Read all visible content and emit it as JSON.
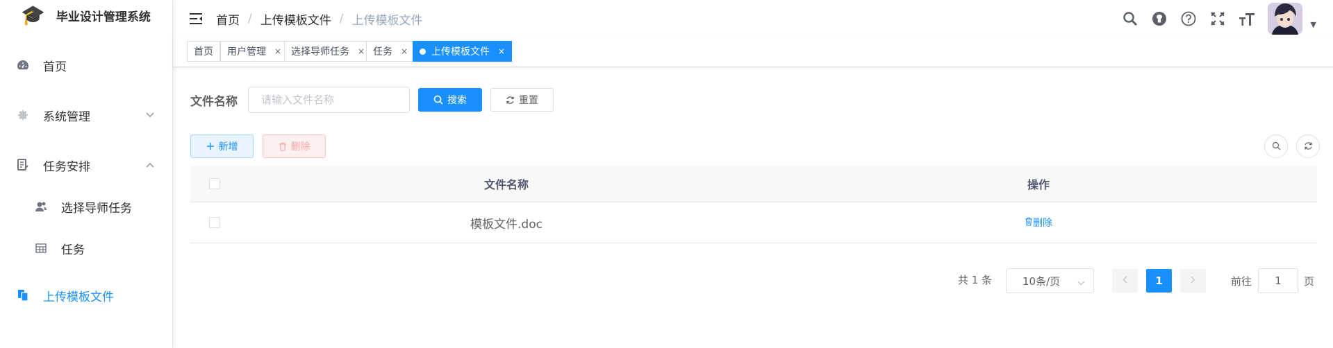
{
  "app": {
    "title": "毕业设计管理系统"
  },
  "sidebar": {
    "items": [
      {
        "label": "首页"
      },
      {
        "label": "系统管理"
      },
      {
        "label": "任务安排"
      },
      {
        "label": "选择导师任务"
      },
      {
        "label": "任务"
      },
      {
        "label": "上传模板文件"
      }
    ]
  },
  "breadcrumb": [
    "首页",
    "上传模板文件",
    "上传模板文件"
  ],
  "breadcrumb_sep": "/",
  "tags": [
    {
      "label": "首页"
    },
    {
      "label": "用户管理",
      "close": "×"
    },
    {
      "label": "选择导师任务",
      "close": "×"
    },
    {
      "label": "任务",
      "close": "×"
    },
    {
      "label": "上传模板文件",
      "close": "×"
    }
  ],
  "search": {
    "label": "文件名称",
    "placeholder": "请输入文件名称",
    "value": "",
    "search_button": "搜索",
    "reset_button": "重置"
  },
  "toolbar": {
    "add_button": "新增",
    "delete_button": "删除"
  },
  "table": {
    "columns": [
      "文件名称",
      "操作"
    ],
    "rows": [
      {
        "name": "模板文件.doc",
        "action": "删除"
      }
    ]
  },
  "pagination": {
    "total": "共 1 条",
    "page_size": "10条/页",
    "current_page": "1",
    "goto_label": "前往",
    "goto_value": "1",
    "page_suffix": "页"
  },
  "colors": {
    "primary": "#1890ff",
    "danger_light": "#fef0f0",
    "border": "#dcdfe6"
  },
  "icons": [
    "graduation-cap-icon",
    "dashboard-icon",
    "gear-icon",
    "task-list-icon",
    "user-group-icon",
    "table-icon",
    "upload-file-icon",
    "hamburger-icon",
    "search-icon",
    "github-icon",
    "question-icon",
    "fullscreen-icon",
    "font-size-icon",
    "refresh-icon",
    "plus-icon",
    "trash-icon"
  ]
}
